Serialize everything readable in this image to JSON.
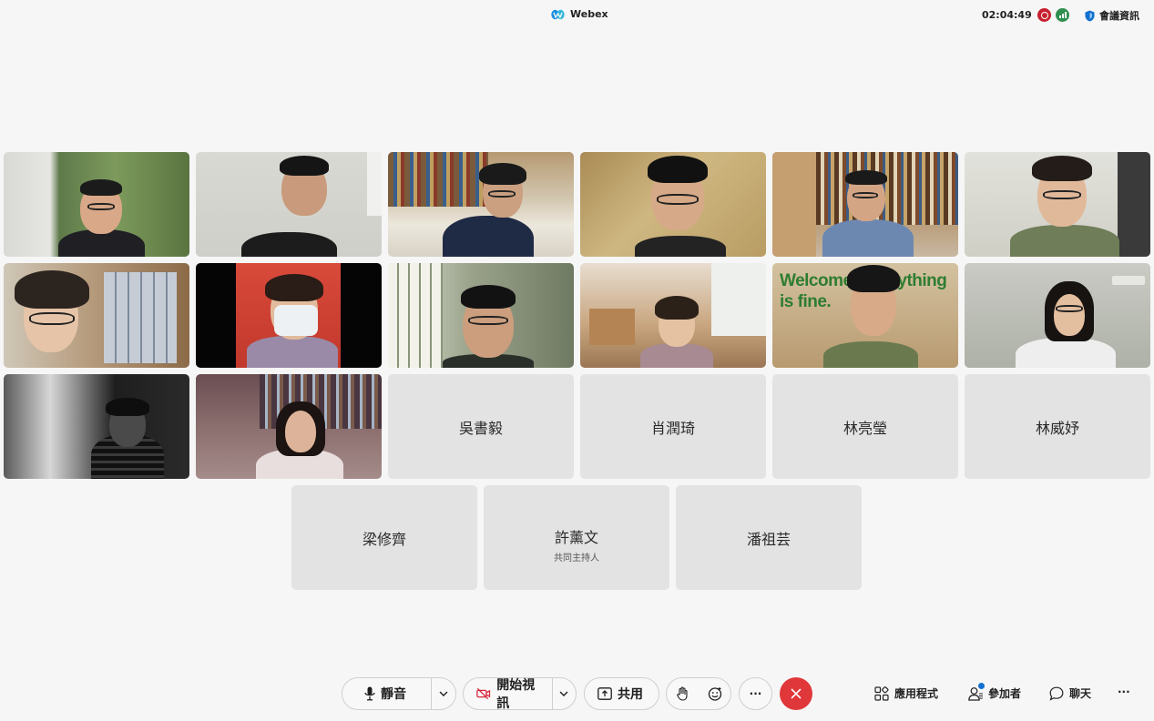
{
  "topbar": {
    "app_name": "Webex",
    "clock": "02:04:49",
    "meeting_info_label": "會議資訊"
  },
  "participants_no_video": [
    {
      "name": "吳書毅",
      "role": ""
    },
    {
      "name": "肖潤琦",
      "role": ""
    },
    {
      "name": "林亮瑩",
      "role": ""
    },
    {
      "name": "林威妤",
      "role": ""
    },
    {
      "name": "梁修齊",
      "role": ""
    },
    {
      "name": "許薰文",
      "role": "共同主持人"
    },
    {
      "name": "潘祖芸",
      "role": ""
    }
  ],
  "video_tile_banner": "Welcome! Everything is fine.",
  "controls": {
    "mute_label": "靜音",
    "video_label": "開始視訊",
    "share_label": "共用",
    "more_label": "···",
    "apps_label": "應用程式",
    "participants_label": "參加者",
    "chat_label": "聊天",
    "overflow_label": "···"
  },
  "colors": {
    "end_call": "#e0373a",
    "record": "#c7212f",
    "signal": "#2f8f4e",
    "accent": "#1170cf"
  }
}
